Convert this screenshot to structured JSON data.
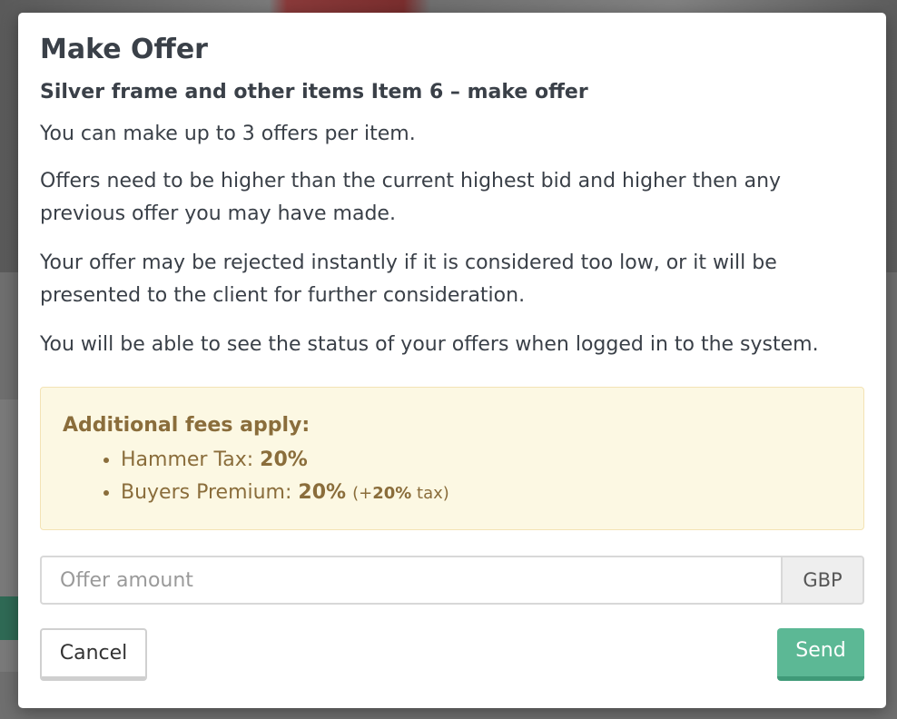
{
  "modal": {
    "title": "Make Offer",
    "subtitle": "Silver frame and other items Item 6 – make offer",
    "paragraphs": [
      "You can make up to 3 offers per item.",
      "Offers need to be higher than the current highest bid and higher then any previous offer you may have made.",
      "Your offer may be rejected instantly if it is considered too low, or it will be presented to the client for further consideration.",
      "You will be able to see the status of your offers when logged in to the system."
    ],
    "fees": {
      "heading": "Additional fees apply:",
      "hammer_tax_label": "Hammer Tax:",
      "hammer_tax_value": "20%",
      "buyers_premium_label": "Buyers Premium:",
      "buyers_premium_value": "20%",
      "buyers_premium_tax_prefix": "(+",
      "buyers_premium_tax_value": "20%",
      "buyers_premium_tax_suffix": "tax)"
    },
    "offer": {
      "placeholder": "Offer amount",
      "value": "",
      "currency": "GBP"
    },
    "buttons": {
      "cancel": "Cancel",
      "send": "Send"
    }
  },
  "colors": {
    "accent_send": "#5cb895",
    "fees_background": "#fcf8e3",
    "fees_text": "#8a6d3b"
  }
}
